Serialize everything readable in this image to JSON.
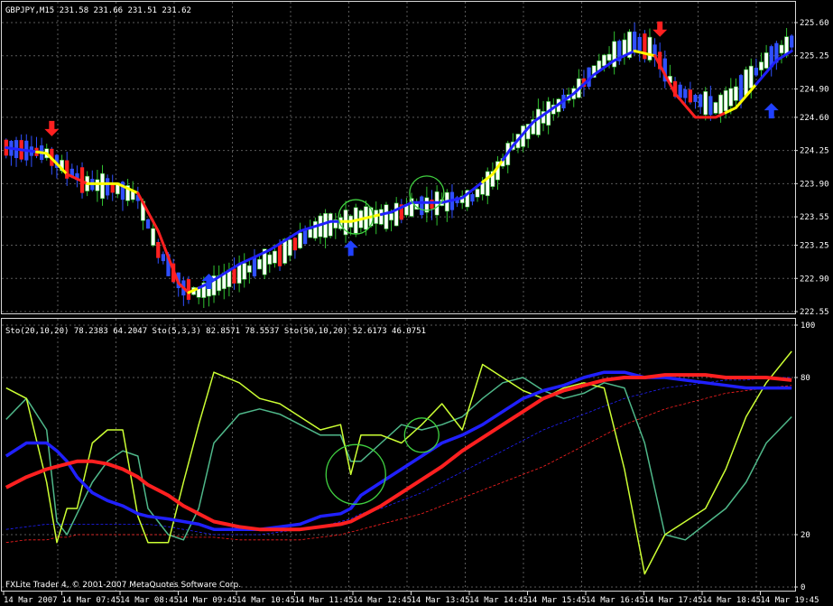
{
  "window": {
    "title": "GBPJPY,M15  231.58 231.66 231.51 231.62",
    "copyright": "FXLite Trader 4, © 2001-2007 MetaQuotes Software Corp."
  },
  "colors": {
    "background": "#000000",
    "grid": "#5a5a5a",
    "frame": "#d8d8d8",
    "candle_up": "#ffffff",
    "candle_down": "#ff2020",
    "candle_up_wick": "#30c030",
    "candle_down_wick": "#3050ff",
    "ma_blue": "#2020ff",
    "ma_red": "#ff2020",
    "ma_yellow": "#ffff00",
    "arrow_up": "#2040ff",
    "arrow_down": "#ff2020",
    "sto_fast": "#ccff33",
    "sto_mid": "#4fb88a",
    "circle": "#40d040"
  },
  "chart_data": [
    {
      "type": "candlestick",
      "title": "GBPJPY,M15  231.58 231.66 231.51 231.62",
      "ylim": [
        222.55,
        225.6
      ],
      "yticks": [
        "225.60",
        "225.25",
        "224.90",
        "224.60",
        "224.25",
        "223.90",
        "223.55",
        "223.25",
        "222.90",
        "222.55"
      ],
      "ytick_values": [
        225.6,
        225.25,
        224.9,
        224.6,
        224.25,
        223.9,
        223.55,
        223.25,
        222.9,
        222.55
      ],
      "bars": 132,
      "price_path": [
        [
          0,
          224.28
        ],
        [
          8,
          224.22
        ],
        [
          12,
          224.05
        ],
        [
          16,
          223.9
        ],
        [
          22,
          223.85
        ],
        [
          26,
          223.75
        ],
        [
          30,
          223.2
        ],
        [
          35,
          222.8
        ],
        [
          38,
          222.75
        ],
        [
          42,
          222.85
        ],
        [
          48,
          223.0
        ],
        [
          54,
          223.15
        ],
        [
          58,
          223.3
        ],
        [
          62,
          223.45
        ],
        [
          68,
          223.5
        ],
        [
          72,
          223.55
        ],
        [
          76,
          223.55
        ],
        [
          80,
          223.65
        ],
        [
          86,
          223.7
        ],
        [
          92,
          223.75
        ],
        [
          96,
          223.95
        ],
        [
          100,
          224.3
        ],
        [
          106,
          224.6
        ],
        [
          112,
          224.85
        ],
        [
          118,
          225.2
        ],
        [
          124,
          225.4
        ],
        [
          128,
          225.3
        ],
        [
          132,
          224.9
        ],
        [
          136,
          224.8
        ],
        [
          140,
          224.7
        ],
        [
          144,
          224.85
        ],
        [
          150,
          225.2
        ],
        [
          155,
          225.4
        ]
      ],
      "ma_path": [
        [
          0,
          224.28
        ],
        [
          8,
          224.22
        ],
        [
          12,
          224.0
        ],
        [
          16,
          223.9
        ],
        [
          22,
          223.9
        ],
        [
          26,
          223.8
        ],
        [
          30,
          223.4
        ],
        [
          34,
          222.85
        ],
        [
          36,
          222.75
        ],
        [
          40,
          222.85
        ],
        [
          46,
          223.05
        ],
        [
          52,
          223.2
        ],
        [
          58,
          223.4
        ],
        [
          64,
          223.5
        ],
        [
          68,
          223.5
        ],
        [
          72,
          223.55
        ],
        [
          76,
          223.6
        ],
        [
          80,
          223.7
        ],
        [
          86,
          223.7
        ],
        [
          90,
          223.75
        ],
        [
          96,
          224.0
        ],
        [
          100,
          224.3
        ],
        [
          104,
          224.55
        ],
        [
          108,
          224.7
        ],
        [
          112,
          224.85
        ],
        [
          116,
          225.05
        ],
        [
          120,
          225.2
        ],
        [
          124,
          225.3
        ],
        [
          128,
          225.25
        ],
        [
          132,
          224.85
        ],
        [
          136,
          224.6
        ],
        [
          140,
          224.6
        ],
        [
          144,
          224.7
        ],
        [
          148,
          224.95
        ],
        [
          152,
          225.2
        ],
        [
          155,
          225.3
        ]
      ],
      "ma_color_ranges": [
        {
          "from": 0,
          "to": 6,
          "color": "ma_blue"
        },
        {
          "from": 6,
          "to": 12,
          "color": "ma_yellow"
        },
        {
          "from": 12,
          "to": 16,
          "color": "ma_red"
        },
        {
          "from": 16,
          "to": 26,
          "color": "ma_yellow"
        },
        {
          "from": 26,
          "to": 36,
          "color": "ma_red"
        },
        {
          "from": 36,
          "to": 38,
          "color": "ma_yellow"
        },
        {
          "from": 38,
          "to": 66,
          "color": "ma_blue"
        },
        {
          "from": 66,
          "to": 74,
          "color": "ma_yellow"
        },
        {
          "from": 74,
          "to": 94,
          "color": "ma_blue"
        },
        {
          "from": 94,
          "to": 98,
          "color": "ma_yellow"
        },
        {
          "from": 98,
          "to": 124,
          "color": "ma_blue"
        },
        {
          "from": 124,
          "to": 128,
          "color": "ma_yellow"
        },
        {
          "from": 128,
          "to": 142,
          "color": "ma_red"
        },
        {
          "from": 142,
          "to": 148,
          "color": "ma_yellow"
        },
        {
          "from": 148,
          "to": 155,
          "color": "ma_blue"
        }
      ],
      "signals": [
        {
          "type": "down",
          "bar": 9,
          "price": 224.4
        },
        {
          "type": "up",
          "bar": 40,
          "price": 222.95
        },
        {
          "type": "up",
          "bar": 68,
          "price": 223.3
        },
        {
          "type": "down",
          "bar": 129,
          "price": 225.45
        },
        {
          "type": "up",
          "bar": 151,
          "price": 224.75
        }
      ],
      "circles": [
        {
          "bar": 69,
          "price": 223.55
        },
        {
          "bar": 83,
          "price": 223.8
        }
      ]
    },
    {
      "type": "line",
      "title": "Sto(20,10,20) 78.2383 64.2047  Sto(5,3,3) 82.8571 78.5537  Sto(50,10,20) 52.6173 46.0751",
      "ylim": [
        0,
        100
      ],
      "yticks": [
        "100",
        "80",
        "20",
        "0"
      ],
      "ytick_values": [
        100,
        80,
        20,
        0
      ],
      "x": [
        0,
        4,
        8,
        10,
        12,
        14,
        17,
        20,
        23,
        26,
        28,
        32,
        35,
        38,
        41,
        46,
        50,
        54,
        58,
        62,
        66,
        68,
        70,
        74,
        78,
        82,
        86,
        90,
        94,
        98,
        102,
        106,
        110,
        114,
        118,
        122,
        126,
        130,
        134,
        138,
        142,
        146,
        150,
        155
      ],
      "series": [
        {
          "name": "Sto(5,3,3)",
          "color": "sto_fast",
          "width": 1.5,
          "values": [
            76,
            72,
            40,
            17,
            30,
            30,
            55,
            60,
            60,
            27,
            17,
            17,
            40,
            62,
            82,
            78,
            72,
            70,
            65,
            60,
            62,
            43,
            58,
            58,
            55,
            62,
            70,
            60,
            85,
            80,
            75,
            72,
            76,
            78,
            76,
            45,
            5,
            20,
            25,
            30,
            45,
            65,
            78,
            90
          ]
        },
        {
          "name": "",
          "color": "sto_mid",
          "width": 1.5,
          "values": [
            64,
            72,
            60,
            25,
            20,
            28,
            40,
            48,
            52,
            50,
            30,
            20,
            18,
            30,
            55,
            66,
            68,
            66,
            62,
            58,
            58,
            48,
            48,
            55,
            62,
            60,
            62,
            65,
            72,
            78,
            80,
            75,
            72,
            74,
            78,
            76,
            55,
            20,
            18,
            24,
            30,
            40,
            55,
            65
          ]
        },
        {
          "name": "",
          "color": "ma_blue",
          "width": 3.5,
          "values": [
            50,
            55,
            55,
            52,
            48,
            42,
            36,
            33,
            31,
            28,
            27,
            26,
            25,
            24,
            22,
            22,
            22,
            23,
            24,
            27,
            28,
            30,
            35,
            40,
            45,
            50,
            55,
            58,
            62,
            67,
            72,
            75,
            77,
            80,
            82,
            82,
            80,
            80,
            79,
            78,
            77,
            76,
            76,
            76
          ]
        },
        {
          "name": "",
          "color": "ma_red",
          "width": 4,
          "values": [
            38,
            42,
            45,
            46,
            47,
            48,
            48,
            47,
            45,
            42,
            39,
            35,
            31,
            28,
            25,
            23,
            22,
            22,
            22,
            23,
            24,
            25,
            27,
            31,
            36,
            41,
            46,
            52,
            57,
            62,
            67,
            72,
            75,
            77,
            79,
            80,
            80,
            81,
            81,
            81,
            80,
            80,
            80,
            79
          ]
        },
        {
          "name": "",
          "color": "ma_blue",
          "width": 0.8,
          "dashed": true,
          "values": [
            22,
            23,
            24,
            24,
            24,
            24,
            24,
            24,
            24,
            24,
            24,
            23,
            22,
            21,
            20,
            20,
            20,
            21,
            22,
            23,
            25,
            26,
            28,
            30,
            33,
            36,
            40,
            44,
            48,
            52,
            56,
            60,
            63,
            66,
            69,
            72,
            74,
            76,
            77,
            78,
            79,
            79,
            80,
            80
          ]
        },
        {
          "name": "",
          "color": "ma_red",
          "width": 0.8,
          "dashed": true,
          "values": [
            17,
            18,
            18,
            19,
            19,
            20,
            20,
            20,
            20,
            20,
            20,
            20,
            19,
            19,
            19,
            18,
            18,
            18,
            18,
            19,
            20,
            21,
            22,
            24,
            26,
            28,
            31,
            34,
            37,
            40,
            43,
            46,
            50,
            54,
            58,
            62,
            65,
            68,
            70,
            72,
            74,
            75,
            76,
            77
          ]
        }
      ],
      "circles": [
        {
          "x": 69,
          "y": 43
        },
        {
          "x": 82,
          "y": 58
        }
      ]
    }
  ],
  "x_axis": {
    "labels": [
      "14 Mar 2007",
      "14 Mar 07:45",
      "14 Mar 08:45",
      "14 Mar 09:45",
      "14 Mar 10:45",
      "14 Mar 11:45",
      "14 Mar 12:45",
      "14 Mar 13:45",
      "14 Mar 14:45",
      "14 Mar 15:45",
      "14 Mar 16:45",
      "14 Mar 17:45",
      "14 Mar 18:45",
      "14 Mar 19:45"
    ],
    "label_bars": [
      0,
      15,
      30,
      45,
      60,
      75,
      90,
      105,
      120,
      135,
      150,
      165,
      180,
      195
    ]
  }
}
